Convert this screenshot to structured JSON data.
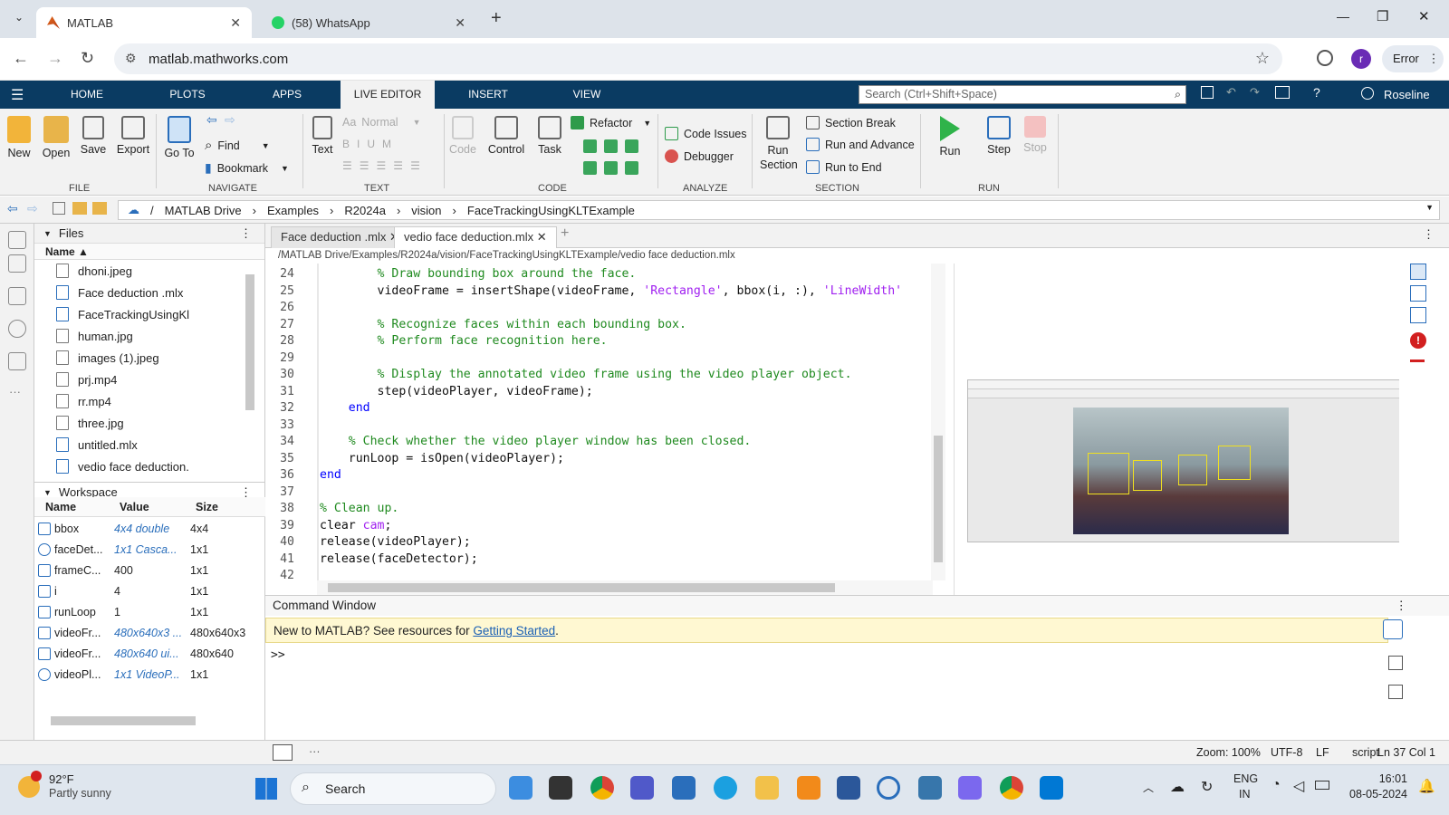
{
  "browser": {
    "tabs": [
      {
        "title": "MATLAB",
        "close": "✕"
      },
      {
        "title": "(58) WhatsApp",
        "close": "✕"
      }
    ],
    "new_tab": "+",
    "url": "matlab.mathworks.com",
    "error_label": "Error",
    "profile_letter": "r",
    "win": {
      "min": "—",
      "max": "❐",
      "close": "✕"
    }
  },
  "ribbon": {
    "tabs": [
      "HOME",
      "PLOTS",
      "APPS",
      "LIVE EDITOR",
      "INSERT",
      "VIEW"
    ],
    "search_placeholder": "Search (Ctrl+Shift+Space)",
    "user": "Roseline",
    "file": {
      "label": "FILE",
      "new": "New",
      "open": "Open",
      "save": "Save",
      "export": "Export"
    },
    "navigate": {
      "label": "NAVIGATE",
      "goto": "Go To",
      "find": "Find",
      "bookmark": "Bookmark"
    },
    "text": {
      "label": "TEXT",
      "text": "Text",
      "normal": "Normal"
    },
    "code": {
      "label": "CODE",
      "code": "Code",
      "control": "Control",
      "task": "Task",
      "refactor": "Refactor"
    },
    "analyze": {
      "label": "ANALYZE",
      "issues": "Code Issues",
      "debugger": "Debugger"
    },
    "section": {
      "label": "SECTION",
      "run_section": "Run Section",
      "section_break": "Section Break",
      "run_advance": "Run and Advance",
      "run_end": "Run to End"
    },
    "run": {
      "label": "RUN",
      "run": "Run",
      "step": "Step",
      "stop": "Stop"
    }
  },
  "path": [
    "/",
    "MATLAB Drive",
    "Examples",
    "R2024a",
    "vision",
    "FaceTrackingUsingKLTExample"
  ],
  "files": {
    "title": "Files",
    "col_name": "Name ▲",
    "items": [
      "dhoni.jpeg",
      "Face deduction .mlx",
      "FaceTrackingUsingKl",
      "human.jpg",
      "images (1).jpeg",
      "prj.mp4",
      "rr.mp4",
      "three.jpg",
      "untitled.mlx",
      "vedio face deduction."
    ]
  },
  "workspace": {
    "title": "Workspace",
    "cols": [
      "Name",
      "Value",
      "Size"
    ],
    "rows": [
      {
        "name": "bbox",
        "value": "4x4 double",
        "size": "4x4"
      },
      {
        "name": "faceDet...",
        "value": "1x1 Casca...",
        "size": "1x1"
      },
      {
        "name": "frameC...",
        "value": "400",
        "size": "1x1"
      },
      {
        "name": "i",
        "value": "4",
        "size": "1x1"
      },
      {
        "name": "runLoop",
        "value": "1",
        "size": "1x1"
      },
      {
        "name": "videoFr...",
        "value": "480x640x3 ...",
        "size": "480x640x3"
      },
      {
        "name": "videoFr...",
        "value": "480x640 ui...",
        "size": "480x640"
      },
      {
        "name": "videoPl...",
        "value": "1x1 VideoP...",
        "size": "1x1"
      }
    ]
  },
  "editor": {
    "tabs": [
      "Face deduction .mlx",
      "vedio face deduction.mlx"
    ],
    "filepath": "/MATLAB Drive/Examples/R2024a/vision/FaceTrackingUsingKLTExample/vedio face deduction.mlx",
    "lines": [
      {
        "n": "24",
        "t": "        % Draw bounding box around the face.",
        "c": "cm"
      },
      {
        "n": "25",
        "t": "        videoFrame = insertShape(videoFrame, 'Rectangle', bbox(i, :), 'LineWidth'",
        "c": ""
      },
      {
        "n": "26",
        "t": "",
        "c": ""
      },
      {
        "n": "27",
        "t": "        % Recognize faces within each bounding box.",
        "c": "cm"
      },
      {
        "n": "28",
        "t": "        % Perform face recognition here.",
        "c": "cm"
      },
      {
        "n": "29",
        "t": "",
        "c": ""
      },
      {
        "n": "30",
        "t": "        % Display the annotated video frame using the video player object.",
        "c": "cm"
      },
      {
        "n": "31",
        "t": "        step(videoPlayer, videoFrame);",
        "c": ""
      },
      {
        "n": "32",
        "t": "    end",
        "c": "kw"
      },
      {
        "n": "33",
        "t": "",
        "c": ""
      },
      {
        "n": "34",
        "t": "    % Check whether the video player window has been closed.",
        "c": "cm"
      },
      {
        "n": "35",
        "t": "    runLoop = isOpen(videoPlayer);",
        "c": ""
      },
      {
        "n": "36",
        "t": "end",
        "c": "kw"
      },
      {
        "n": "37",
        "t": "",
        "c": ""
      },
      {
        "n": "38",
        "t": "% Clean up.",
        "c": "cm"
      },
      {
        "n": "39",
        "t": "clear cam;",
        "c": ""
      },
      {
        "n": "40",
        "t": "release(videoPlayer);",
        "c": ""
      },
      {
        "n": "41",
        "t": "release(faceDetector);",
        "c": ""
      },
      {
        "n": "42",
        "t": "",
        "c": ""
      }
    ]
  },
  "command": {
    "title": "Command Window",
    "notice": "New to MATLAB? See resources for ",
    "link": "Getting Started",
    "after": ".",
    "prompt": ">>"
  },
  "status": {
    "zoom": "Zoom: 100%",
    "enc": "UTF-8",
    "eol": "LF",
    "type": "script",
    "pos": "Ln 37  Col 1"
  },
  "taskbar": {
    "temp": "92°F",
    "weather": "Partly sunny",
    "search": "Search",
    "lang1": "ENG",
    "lang2": "IN",
    "time": "16:01",
    "date": "08-05-2024"
  },
  "colors": {
    "ribbon_bar": "#0a3b62",
    "accent": "#1a5fb4"
  }
}
